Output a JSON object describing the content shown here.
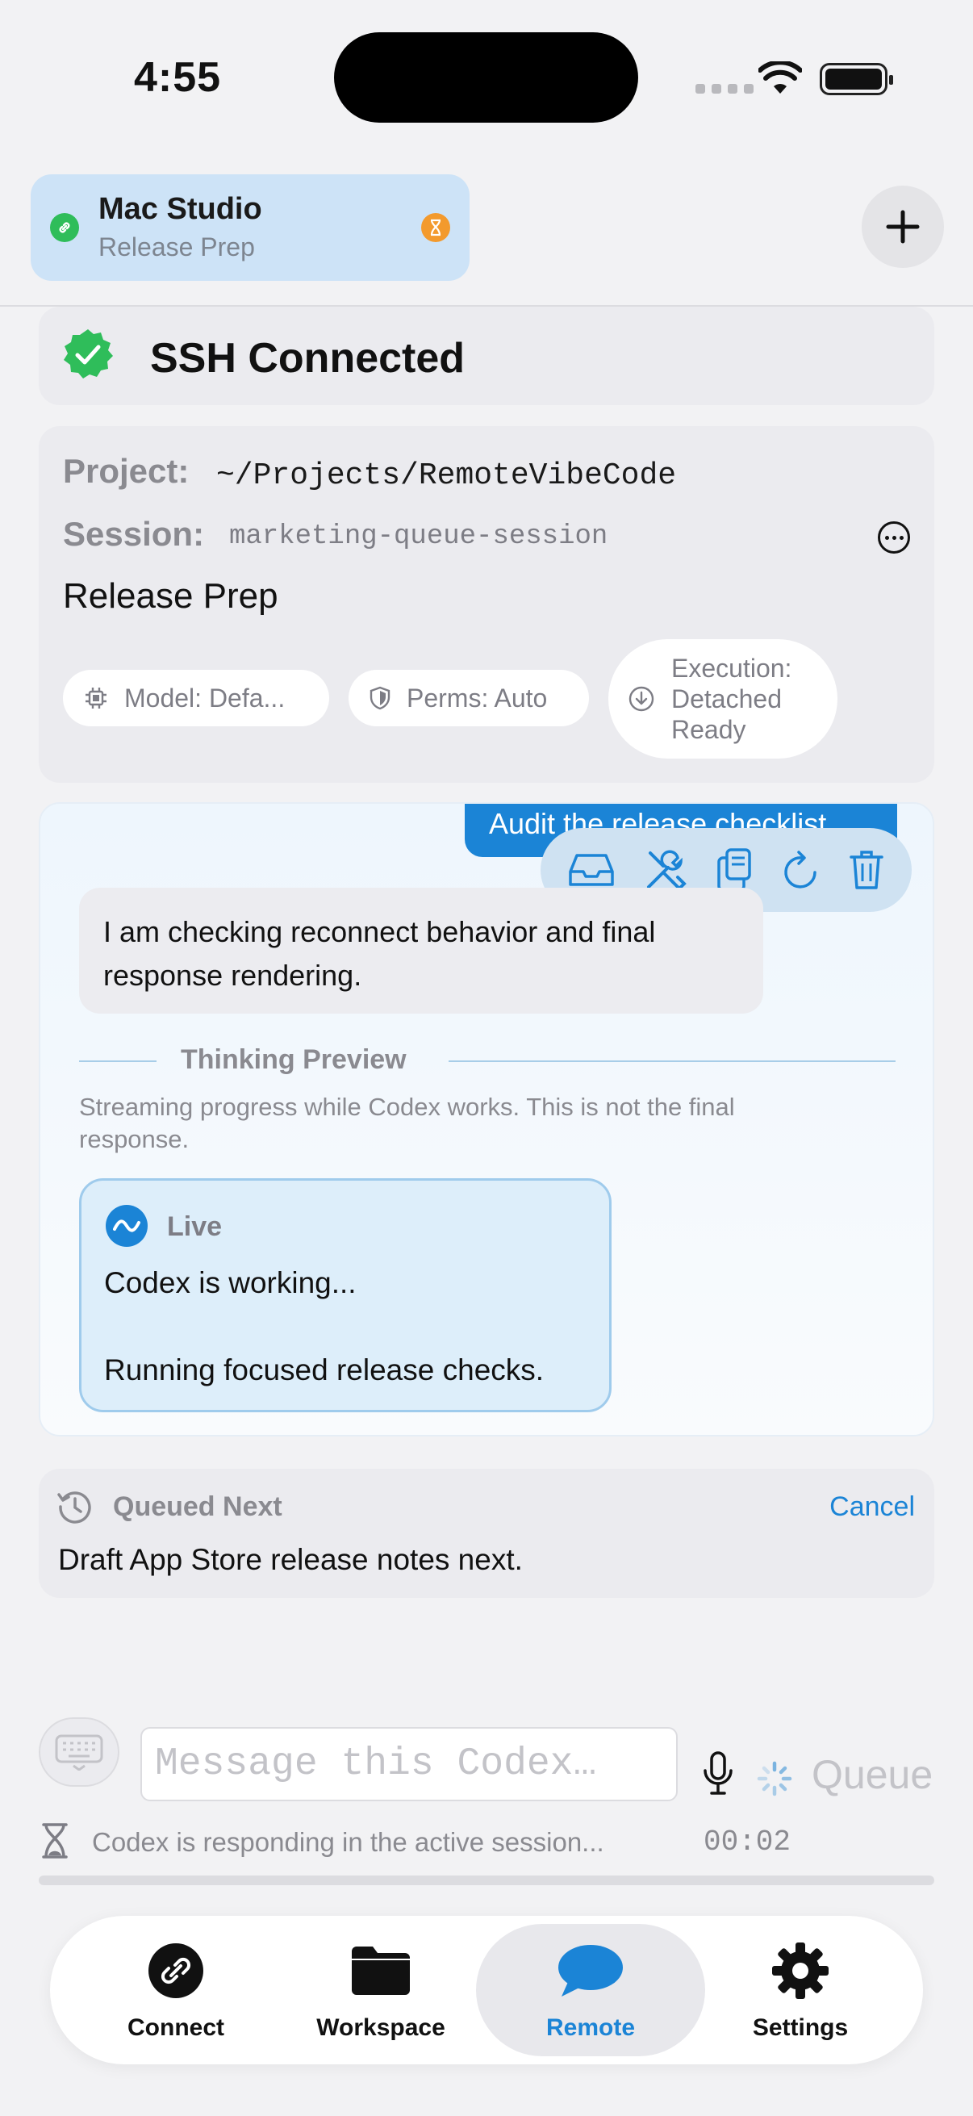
{
  "status_bar": {
    "time": "4:55"
  },
  "host": {
    "name": "Mac Studio",
    "subtitle": "Release Prep"
  },
  "ssh": {
    "title": "SSH Connected"
  },
  "project": {
    "project_label": "Project:",
    "project_path": "~/Projects/RemoteVibeCode",
    "session_label": "Session:",
    "session_name": "marketing-queue-session",
    "title": "Release Prep",
    "chips": {
      "model": "Model: Defa...",
      "perms": "Perms: Auto",
      "execution": [
        "Execution:",
        "Detached",
        "Ready"
      ]
    }
  },
  "chat": {
    "user_message": "Audit the release checklist",
    "assistant_message": "I am checking reconnect behavior and final response rendering.",
    "thinking": {
      "title": "Thinking Preview",
      "description": "Streaming progress while Codex works. This is not the final response."
    },
    "live": {
      "label": "Live",
      "line1": "Codex is working...",
      "line2": "Running focused release checks."
    }
  },
  "queue": {
    "label": "Queued Next",
    "cancel": "Cancel",
    "text": "Draft App Store release notes next."
  },
  "composer": {
    "placeholder": "Message this Codex…",
    "queue_button": "Queue",
    "status_text": "Codex is responding in the active session...",
    "elapsed": "00:02"
  },
  "tabs": {
    "connect": "Connect",
    "workspace": "Workspace",
    "remote": "Remote",
    "settings": "Settings"
  },
  "colors": {
    "accent": "#1b84d6",
    "success": "#2fbd5a",
    "warning": "#f39a2d"
  }
}
